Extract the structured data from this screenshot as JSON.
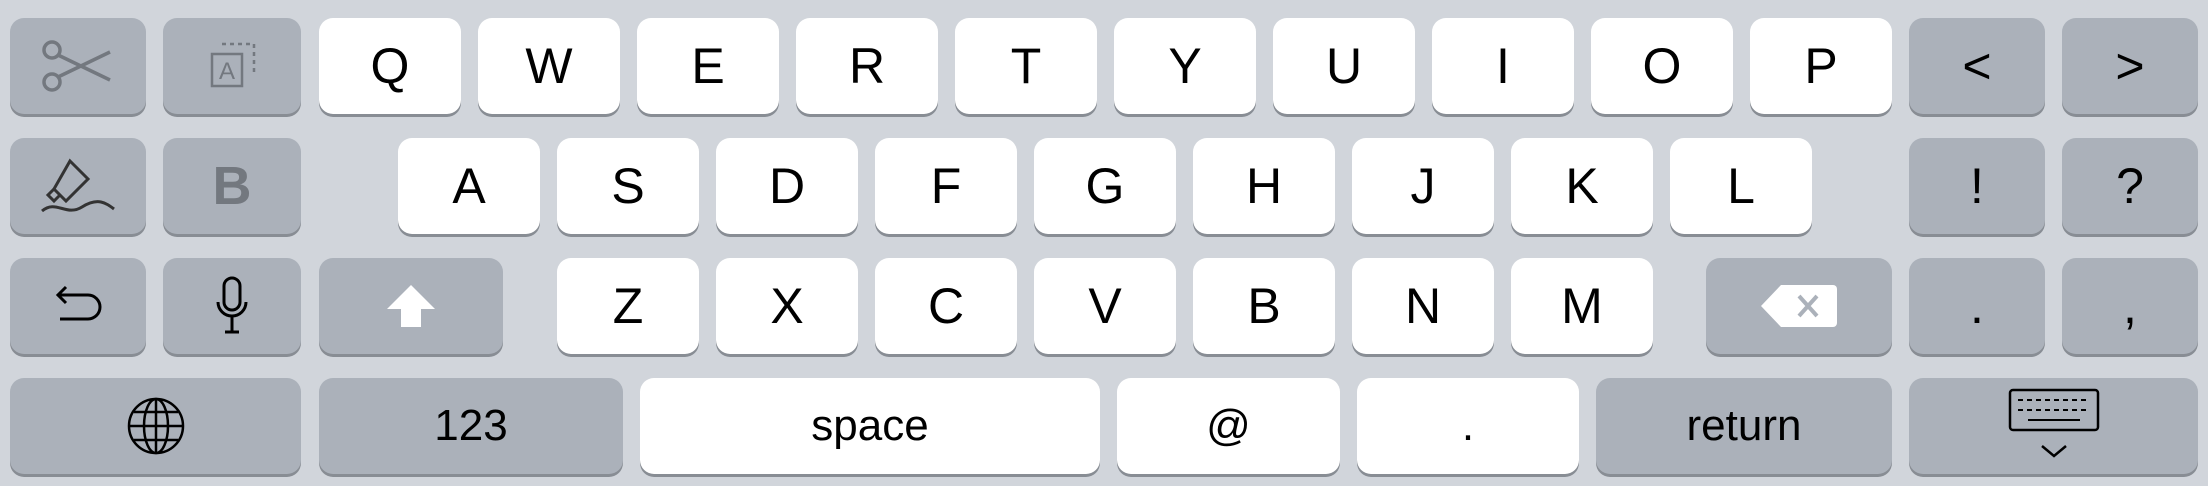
{
  "keyboard": {
    "row1": [
      "Q",
      "W",
      "E",
      "R",
      "T",
      "Y",
      "U",
      "I",
      "O",
      "P"
    ],
    "row2": [
      "A",
      "S",
      "D",
      "F",
      "G",
      "H",
      "J",
      "K",
      "L"
    ],
    "row3": [
      "Z",
      "X",
      "C",
      "V",
      "B",
      "N",
      "M"
    ],
    "punct": {
      "exclaim": "!",
      "question": "?",
      "period": ".",
      "comma": ","
    },
    "bold_label": "B",
    "format_icon_letter": "A",
    "bottom": {
      "numbers": "123",
      "space": "space",
      "at": "@",
      "period": ".",
      "return": "return"
    },
    "arrows": {
      "left": "<",
      "right": ">"
    },
    "colors": {
      "key_light": "#ffffff",
      "key_dark": "#abb1ba",
      "background": "#d1d5db",
      "icon_gray": "#73787f"
    }
  }
}
